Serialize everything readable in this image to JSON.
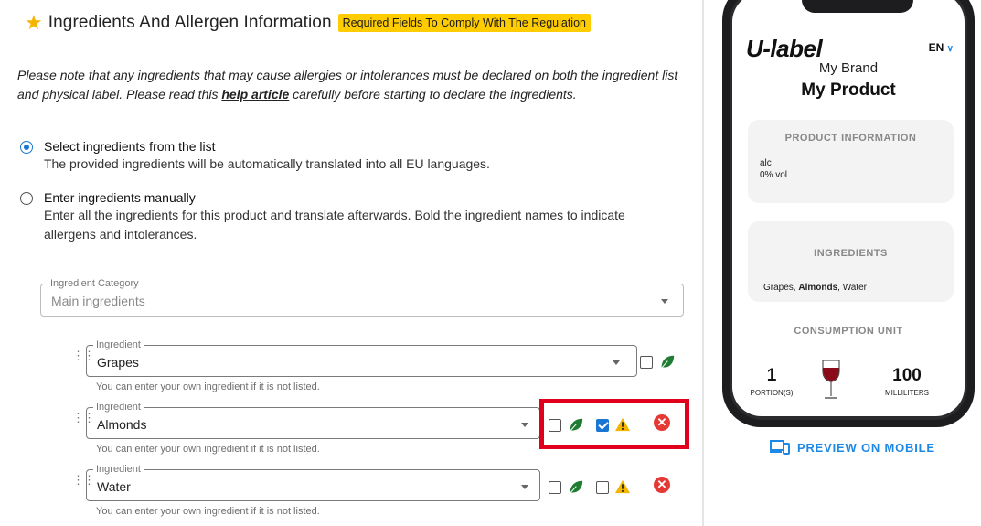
{
  "header": {
    "star_icon": "star-icon",
    "title": "Ingredients And Allergen Information",
    "badge": "Required Fields To Comply With The Regulation"
  },
  "note": {
    "before": "Please note that any ingredients that may cause allergies or intolerances must be declared on both the ingredient list and physical label. Please read this ",
    "link": "help article",
    "after": " carefully before starting to declare the ingredients."
  },
  "options": [
    {
      "label": "Select ingredients from the list",
      "desc": "The provided ingredients will be automatically translated into all EU languages.",
      "selected": true
    },
    {
      "label": "Enter ingredients manually",
      "desc": "Enter all the ingredients for this product and translate afterwards. Bold the ingredient names to indicate allergens and intolerances.",
      "selected": false
    }
  ],
  "category": {
    "legend": "Ingredient Category",
    "value": "Main ingredients"
  },
  "ingredients": [
    {
      "legend": "Ingredient",
      "value": "Grapes",
      "helper": "You can enter your own ingredient if it is not listed.",
      "organic": false,
      "allergen": null
    },
    {
      "legend": "Ingredient",
      "value": "Almonds",
      "helper": "You can enter your own ingredient if it is not listed.",
      "organic": false,
      "allergen": true
    },
    {
      "legend": "Ingredient",
      "value": "Water",
      "helper": "You can enter your own ingredient if it is not listed.",
      "organic": false,
      "allergen": false
    }
  ],
  "preview": {
    "logo": "U-label",
    "lang": "EN",
    "brand": "My Brand",
    "product": "My Product",
    "product_info_title": "PRODUCT INFORMATION",
    "alc_label": "alc",
    "alc_value": "0% vol",
    "ingredients_title": "INGREDIENTS",
    "ingredients_list": {
      "first": "Grapes, ",
      "bold": "Almonds",
      "rest": ", Water"
    },
    "consumption_title": "CONSUMPTION UNIT",
    "portions_value": "1",
    "portions_label": "PORTION(S)",
    "volume_value": "100",
    "volume_label": "MILLILITERS"
  },
  "preview_button": "PREVIEW ON MOBILE",
  "colors": {
    "accent": "#1976d2",
    "badge": "#ffcc00",
    "highlight": "#e0001b",
    "remove": "#e53935",
    "leaf": "#1e7d32",
    "warning": "#f5b400"
  }
}
